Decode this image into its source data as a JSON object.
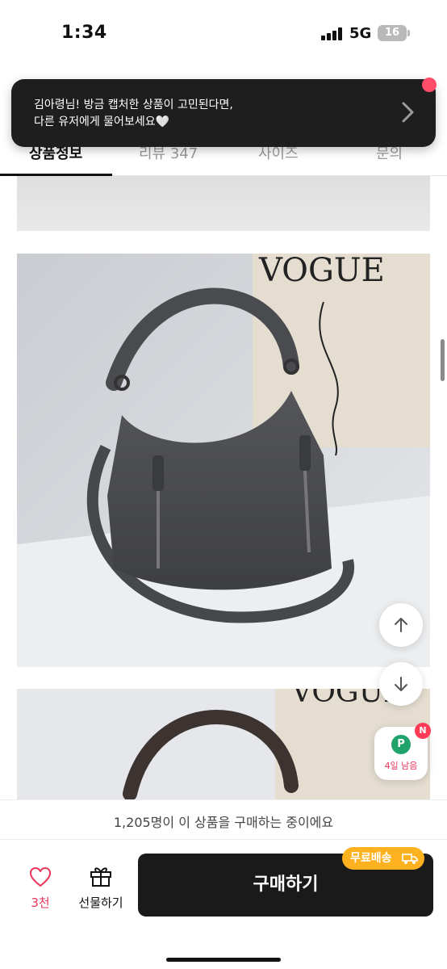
{
  "status_bar": {
    "time": "1:34",
    "network": "5G",
    "battery": "16"
  },
  "tabs": [
    {
      "label": "상품정보"
    },
    {
      "label": "리뷰 347"
    },
    {
      "label": "사이즈"
    },
    {
      "label": "문의"
    }
  ],
  "toast": {
    "line1": "김아령님! 방금 캡처한 상품이 고민된다면,",
    "line2": "다른 유저에게 물어보세요🤍"
  },
  "product_image": {
    "magazine_title": "VOGUE"
  },
  "points_widget": {
    "icon_letter": "P",
    "label": "4일 남음",
    "badge": "N"
  },
  "bottom_bar": {
    "buyers_text": "1,205명이 이 상품을 구매하는 중이에요",
    "like_count": "3천",
    "gift_label": "선물하기",
    "buy_label": "구매하기",
    "shipping_badge": "무료배송"
  },
  "colors": {
    "accent_pink": "#e9365a",
    "shipping_orange": "#ffb21f",
    "points_green": "#1fa36a",
    "buy_button": "#1a1a1a"
  }
}
